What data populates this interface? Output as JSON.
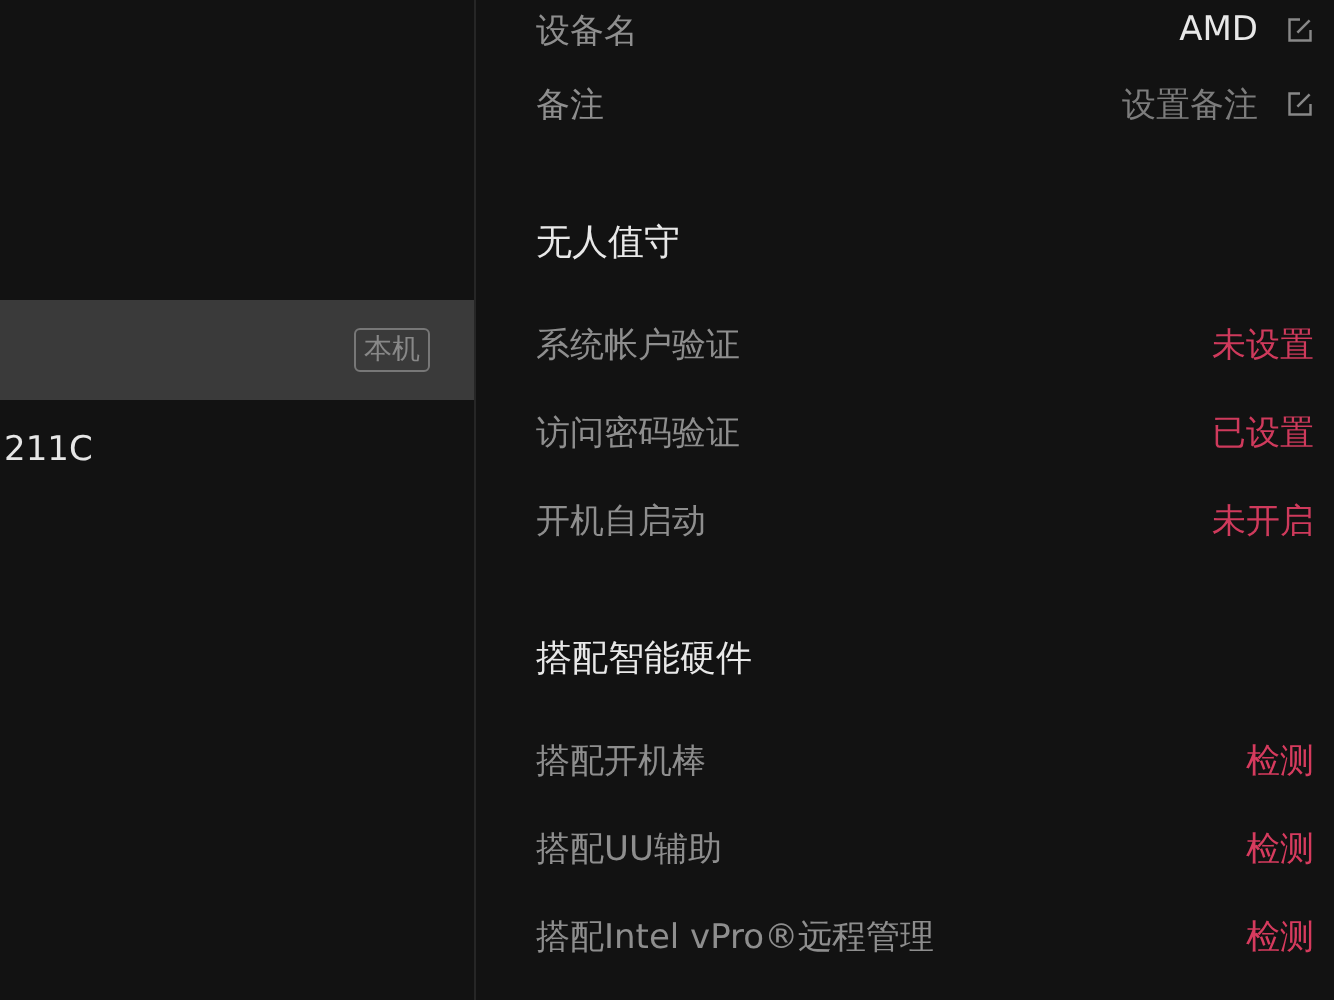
{
  "devices": [
    {
      "badge": "本机",
      "selected": true
    },
    {
      "name": "211C",
      "selected": false
    }
  ],
  "info": [
    {
      "label": "设备名",
      "value": "AMD",
      "kind": "edit",
      "bright": true
    },
    {
      "label": "备注",
      "value": "设置备注",
      "kind": "edit",
      "bright": false
    }
  ],
  "sections": [
    {
      "title": "无人值守",
      "rows": [
        {
          "label": "系统帐户验证",
          "value": "未设置",
          "kind": "status"
        },
        {
          "label": "访问密码验证",
          "value": "已设置",
          "kind": "status"
        },
        {
          "label": "开机自启动",
          "value": "未开启",
          "kind": "status"
        }
      ]
    },
    {
      "title": "搭配智能硬件",
      "rows": [
        {
          "label": "搭配开机棒",
          "value": "检测",
          "kind": "link"
        },
        {
          "label": "搭配UU辅助",
          "value": "检测",
          "kind": "link"
        },
        {
          "label": "搭配Intel vPro®远程管理",
          "value": "检测",
          "kind": "link"
        }
      ]
    }
  ]
}
